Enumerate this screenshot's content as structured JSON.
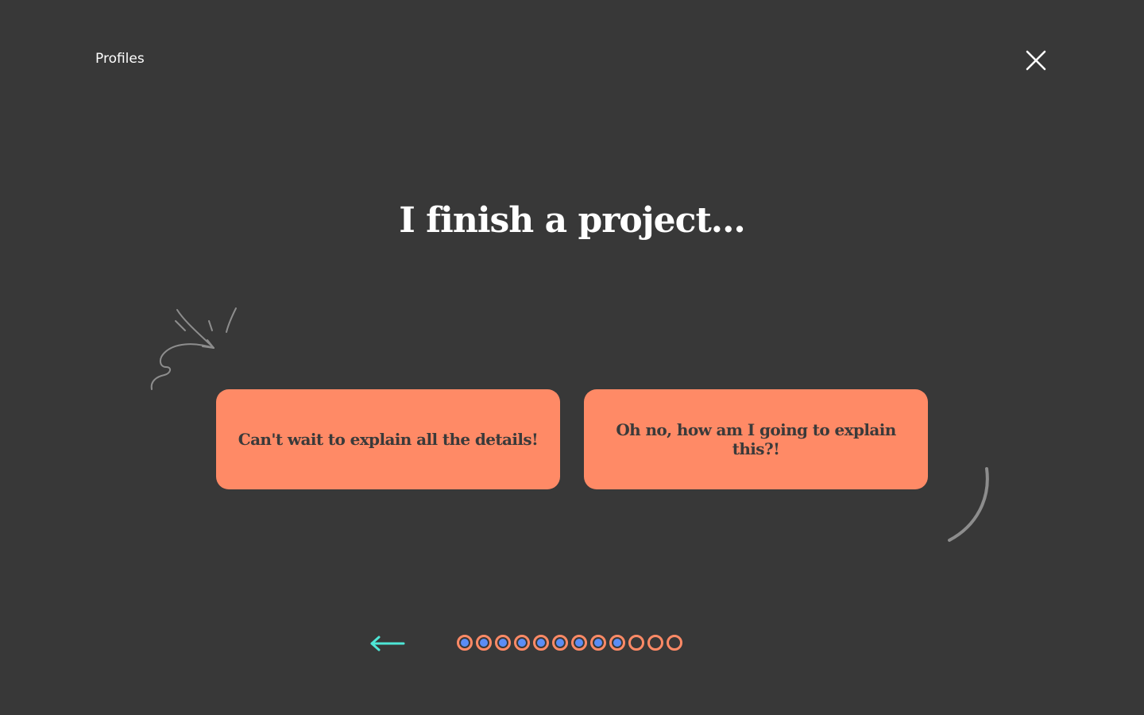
{
  "header": {
    "profiles_link": "Profiles"
  },
  "question": {
    "text": "I finish a project..."
  },
  "answers": [
    {
      "label": "Can't wait to explain all the details!"
    },
    {
      "label": "Oh no, how am I going to explain this?!"
    }
  ],
  "progress": {
    "total_steps": 12,
    "completed_steps": 9
  },
  "icons": {
    "close": "close-icon",
    "back": "back-arrow-icon"
  },
  "colors": {
    "background": "#383838",
    "accent": "#ff8a66",
    "dot_fill": "#5b8df5",
    "back_arrow": "#4ee6d6"
  }
}
